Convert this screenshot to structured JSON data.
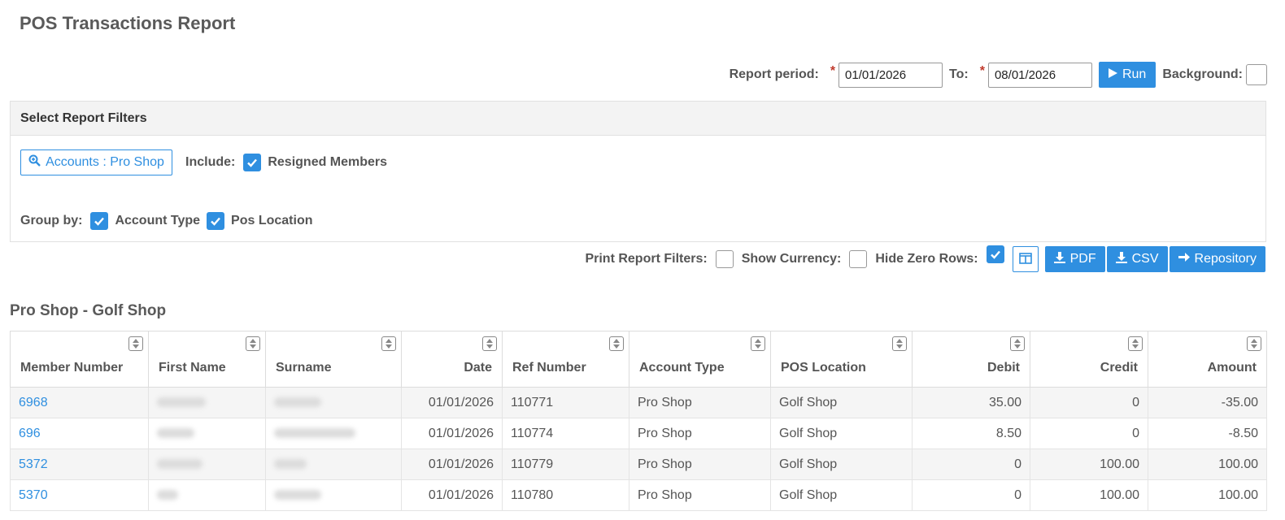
{
  "title": "POS Transactions Report",
  "period": {
    "label": "Report period:",
    "from": "01/01/2026",
    "to_label": "To:",
    "to": "08/01/2026",
    "run_label": "Run",
    "background_label": "Background:"
  },
  "filters": {
    "header": "Select Report Filters",
    "accounts_label": "Accounts : Pro Shop",
    "include_label": "Include:",
    "resigned_label": "Resigned Members",
    "group_by_label": "Group by:",
    "group_account_type": "Account Type",
    "group_pos_location": "Pos Location"
  },
  "options": {
    "print_filters_label": "Print Report Filters:",
    "show_currency_label": "Show Currency:",
    "hide_zero_label": "Hide Zero Rows:",
    "pdf_label": "PDF",
    "csv_label": "CSV",
    "repository_label": "Repository"
  },
  "section_title": "Pro Shop - Golf Shop",
  "table": {
    "headers": [
      "Member Number",
      "First Name",
      "Surname",
      "Date",
      "Ref Number",
      "Account Type",
      "POS Location",
      "Debit",
      "Credit",
      "Amount"
    ],
    "rows": [
      {
        "member": "6968",
        "date": "01/01/2026",
        "ref": "110771",
        "account_type": "Pro Shop",
        "location": "Golf Shop",
        "debit": "35.00",
        "credit": "0",
        "amount": "-35.00"
      },
      {
        "member": "696",
        "date": "01/01/2026",
        "ref": "110774",
        "account_type": "Pro Shop",
        "location": "Golf Shop",
        "debit": "8.50",
        "credit": "0",
        "amount": "-8.50"
      },
      {
        "member": "5372",
        "date": "01/01/2026",
        "ref": "110779",
        "account_type": "Pro Shop",
        "location": "Golf Shop",
        "debit": "0",
        "credit": "100.00",
        "amount": "100.00"
      },
      {
        "member": "5370",
        "date": "01/01/2026",
        "ref": "110780",
        "account_type": "Pro Shop",
        "location": "Golf Shop",
        "debit": "0",
        "credit": "100.00",
        "amount": "100.00"
      }
    ]
  },
  "colors": {
    "accent": "#2f8fe0",
    "required": "#c0392b"
  }
}
